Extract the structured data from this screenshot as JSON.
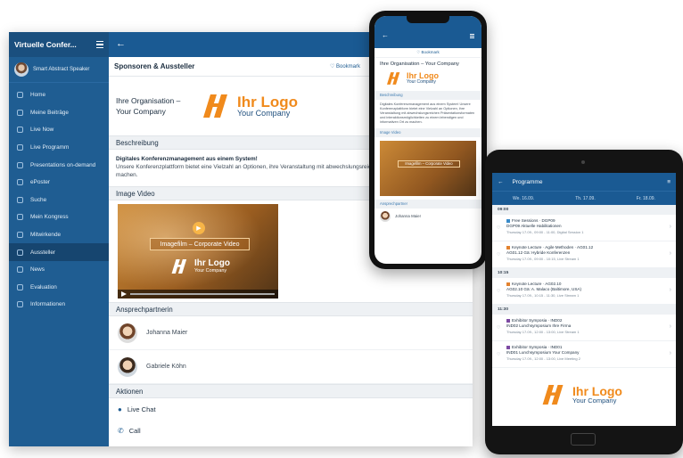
{
  "desktop": {
    "sidebar": {
      "title": "Virtuelle Confer...",
      "profile_name": "Smart Abstract Speaker",
      "items": [
        {
          "label": "Home"
        },
        {
          "label": "Meine Beiträge"
        },
        {
          "label": "Live Now"
        },
        {
          "label": "Live Programm"
        },
        {
          "label": "Presentations on-demand"
        },
        {
          "label": "ePoster"
        },
        {
          "label": "Suche"
        },
        {
          "label": "Mein Kongress"
        },
        {
          "label": "Mitwirkende"
        },
        {
          "label": "Aussteller",
          "active": true
        },
        {
          "label": "News"
        },
        {
          "label": "Evaluation"
        },
        {
          "label": "Informationen"
        }
      ]
    },
    "page_title": "Sponsoren & Aussteller",
    "bookmark": "♡ Bookmark",
    "org_name": "Ihre Organisation – Your Company",
    "logo": {
      "line1": "Ihr Logo",
      "line2": "Your Company"
    },
    "sections": {
      "description": "Beschreibung",
      "video": "Image Video",
      "contacts": "Ansprechpartnerin",
      "actions": "Aktionen"
    },
    "description_title": "Digitales Konferenzmanagement aus einem System!",
    "description_text": "Unsere Konferenzplattform bietet eine Vielzahl an Optionen, ihre Veranstaltung mit abwechslungsreich lebendigen und informativen Ort zu machen.",
    "video_caption": "Imagefilm – Corporate Video",
    "contacts": [
      {
        "name": "Johanna Maier"
      },
      {
        "name": "Gabriele Köhn"
      }
    ],
    "actions": [
      {
        "label": "Live Chat"
      },
      {
        "label": "Call"
      }
    ]
  },
  "phone": {
    "bookmark": "♡ Bookmark",
    "org_name": "Ihre Organisation – Your Company",
    "section_description": "Beschreibung",
    "description_text": "Digitales Konferenzmanagement aus einem System! Unsere Konferenzplattform bietet eine Vielzahl an Optionen, ihre Veranstaltung mit abwechslungsreichen Präsentationsformaten und interaktionsmöglichkeiten zu einem lebendigen und informativen Ort zu machen.",
    "section_video": "Image Video",
    "video_caption": "Imagefilm – Corporate Video",
    "section_contact": "Ansprechpartner",
    "contact_name": "Johanna Maier"
  },
  "tablet": {
    "title": "Programme",
    "days": [
      "We. 16.09.",
      "Th. 17.09.",
      "Fr. 18.09."
    ],
    "slots": [
      {
        "time": "09:00",
        "sessions": [
          {
            "line1": "Free Sessions · DGP09",
            "line2": "DGP09 Aktuelle Habilitationen",
            "line3": "Thursday 17.09., 09:00 - 11:00, Digital Session 1"
          },
          {
            "line1": "Keynote Lecture · Agile Methoden · AG01.12",
            "line2": "AG01.12 Gä: Hybride Konferenzen",
            "line3": "Thursday 17.09., 09:00 - 10:15, Live Stream 1"
          }
        ]
      },
      {
        "time": "10:15",
        "sessions": [
          {
            "line1": "Keynote Lecture · AG02.10",
            "line2": "AG02.10 Gä: A. Malaco (Baltimore, USA)",
            "line3": "Thursday 17.09., 10:15 - 11:30, Live Stream 1"
          }
        ]
      },
      {
        "time": "11:30",
        "sessions": [
          {
            "line1": "Exhibitor Symposia · IND02",
            "line2": "IND02 Lunchsymposium Ihre Firma",
            "line3": "Thursday 17.09., 12:00 - 13:00, Live Stream 1"
          },
          {
            "line1": "Exhibitor Symposia · IND01",
            "line2": "IND01 Lunchsymposium Your Company",
            "line3": "Thursday 17.09., 12:00 - 13:00, Live Meeting 2"
          }
        ]
      }
    ]
  }
}
